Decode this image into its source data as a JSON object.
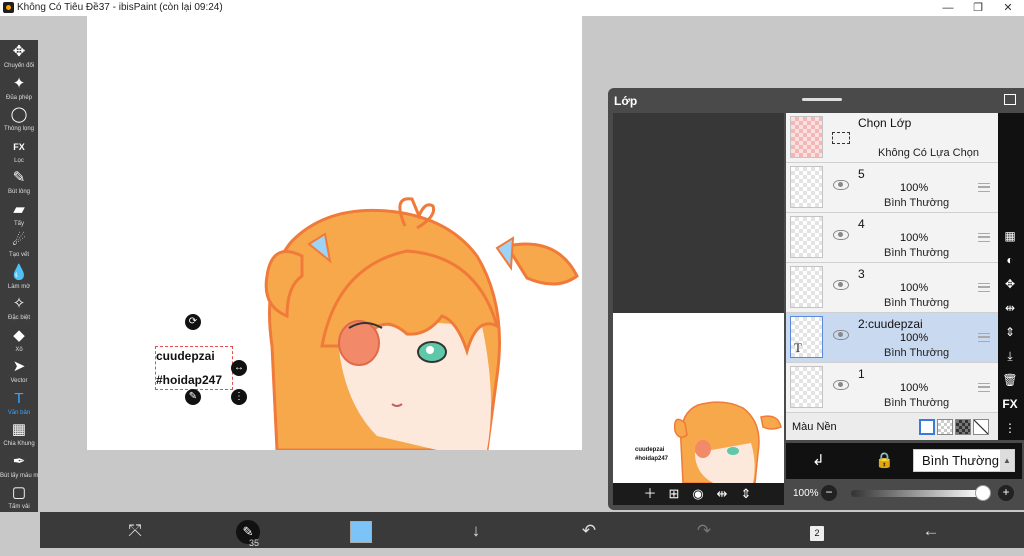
{
  "window": {
    "title": "Không Có Tiêu Đề37 - ibisPaint (còn lại 09:24)",
    "controls": [
      "—",
      "❐",
      "✕"
    ]
  },
  "toolbar": {
    "items": [
      {
        "icon": "move-icon",
        "glyph": "✥",
        "label": "Chuyển đổi",
        "active": false
      },
      {
        "icon": "magic-wand-icon",
        "glyph": "✦",
        "label": "Đũa phép",
        "active": false
      },
      {
        "icon": "lasso-icon",
        "glyph": "◯",
        "label": "Thòng lọng",
        "active": false
      },
      {
        "icon": "fx-icon",
        "glyph": "FX",
        "label": "Lọc",
        "active": false
      },
      {
        "icon": "brush-icon",
        "glyph": "✎",
        "label": "Bút lông",
        "active": false
      },
      {
        "icon": "eraser-icon",
        "glyph": "▰",
        "label": "Tẩy",
        "active": false
      },
      {
        "icon": "smudge-icon",
        "glyph": "☄",
        "label": "Tạo vết",
        "active": false
      },
      {
        "icon": "blur-icon",
        "glyph": "💧",
        "label": "Làm mờ",
        "active": false
      },
      {
        "icon": "special-icon",
        "glyph": "✧",
        "label": "Đặc biệt",
        "active": false
      },
      {
        "icon": "fill-icon",
        "glyph": "◆",
        "label": "Xô",
        "active": false
      },
      {
        "icon": "vector-icon",
        "glyph": "➤",
        "label": "Vector",
        "active": false
      },
      {
        "icon": "text-icon",
        "glyph": "T",
        "label": "Văn bản",
        "active": true
      },
      {
        "icon": "frame-divider-icon",
        "glyph": "▦",
        "label": "Chia Khung",
        "active": false
      },
      {
        "icon": "eyedropper-icon",
        "glyph": "✒",
        "label": "Bút lấy mẫu màu",
        "active": false
      },
      {
        "icon": "canvas-icon",
        "glyph": "▢",
        "label": "Tấm vải",
        "active": false
      }
    ]
  },
  "canvas": {
    "text_lines": [
      "cuudepzai",
      "#hoidap247"
    ]
  },
  "layer_panel": {
    "title": "Lớp",
    "selection_layer": {
      "name": "Chọn Lớp",
      "status": "Không Có Lựa Chọn"
    },
    "layers": [
      {
        "name": "5",
        "opacity": "100%",
        "mode": "Bình Thường",
        "selected": false
      },
      {
        "name": "4",
        "opacity": "100%",
        "mode": "Bình Thường",
        "selected": false
      },
      {
        "name": "3",
        "opacity": "100%",
        "mode": "Bình Thường",
        "selected": false
      },
      {
        "name": "2:cuudepzai",
        "opacity": "100%",
        "mode": "Bình Thường",
        "selected": true
      },
      {
        "name": "1",
        "opacity": "100%",
        "mode": "Bình Thường",
        "selected": false
      }
    ],
    "background_label": "Màu Nền",
    "blend_mode": "Bình Thường",
    "opacity_label": "100%",
    "opacity_value": 1.0,
    "preview_text": [
      "cuudepzai",
      "#hoidap247"
    ],
    "fx_label": "FX",
    "layer_count": "2",
    "brush_size": "35"
  },
  "colors": {
    "accent": "#3aa2ff",
    "current_color": "#7cc4f7",
    "selected_layer": "#c9d9ef"
  }
}
